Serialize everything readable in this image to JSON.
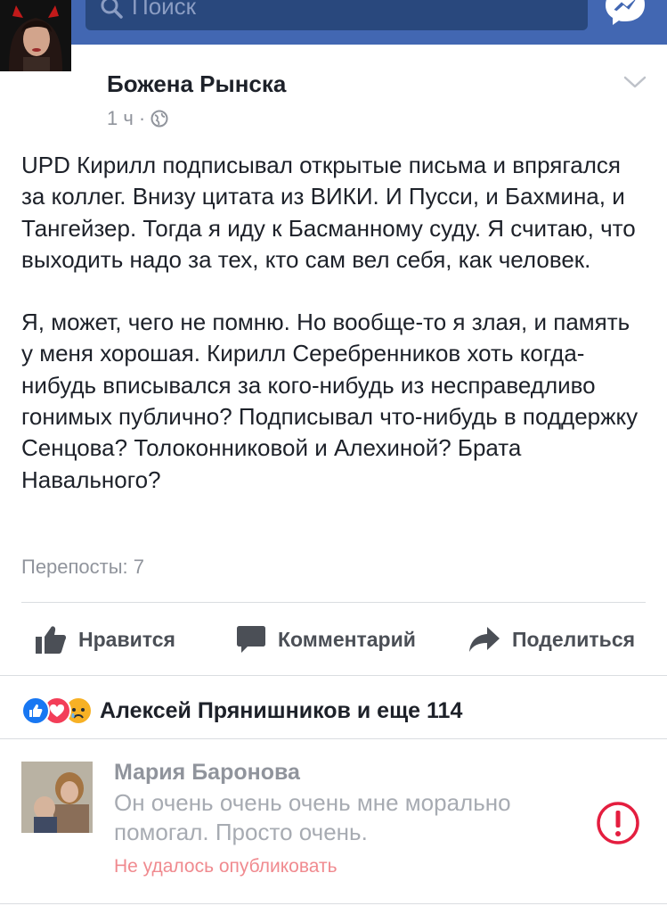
{
  "header": {
    "search_placeholder": "Поиск",
    "icons": [
      "back-arrow-icon",
      "search-icon",
      "messenger-icon"
    ],
    "bar_color": "#4267b2"
  },
  "post": {
    "author": "Божена Рынска",
    "time": "1 ч",
    "separator": "·",
    "privacy_icon": "globe-icon",
    "paragraphs": [
      "UPD Кирилл подписывал открытые письма и впрягался за коллег. Внизу цитата из ВИКИ. И Пусси, и Бахмина, и Тангейзер. Тогда я иду к Басманному суду. Я считаю, что выходить надо за тех, кто сам вел себя, как человек.",
      "Я, может, чего не помню. Но вообще-то я злая, и память у меня хорошая. Кирилл Серебренников хоть когда-нибудь вписывался за кого-нибудь из несправедливо гонимых публично? Подписывал что-нибудь в поддержку Сенцова? Толоконниковой и Алехиной? Брата Навального?"
    ],
    "reposts": "Перепосты: 7"
  },
  "actions": {
    "like": "Нравится",
    "comment": "Комментарий",
    "share": "Поделиться"
  },
  "reactions": {
    "icons": [
      "like-reaction-icon",
      "love-reaction-icon",
      "sad-reaction-icon"
    ],
    "summary": "Алексей Прянишников и еще 114"
  },
  "comment": {
    "author": "Мария Баронова",
    "text": "Он очень очень очень мне морально помогал. Просто очень.",
    "error": "Не удалось опубликовать",
    "error_icon": "alert-icon",
    "error_color": "#e41e3f"
  }
}
